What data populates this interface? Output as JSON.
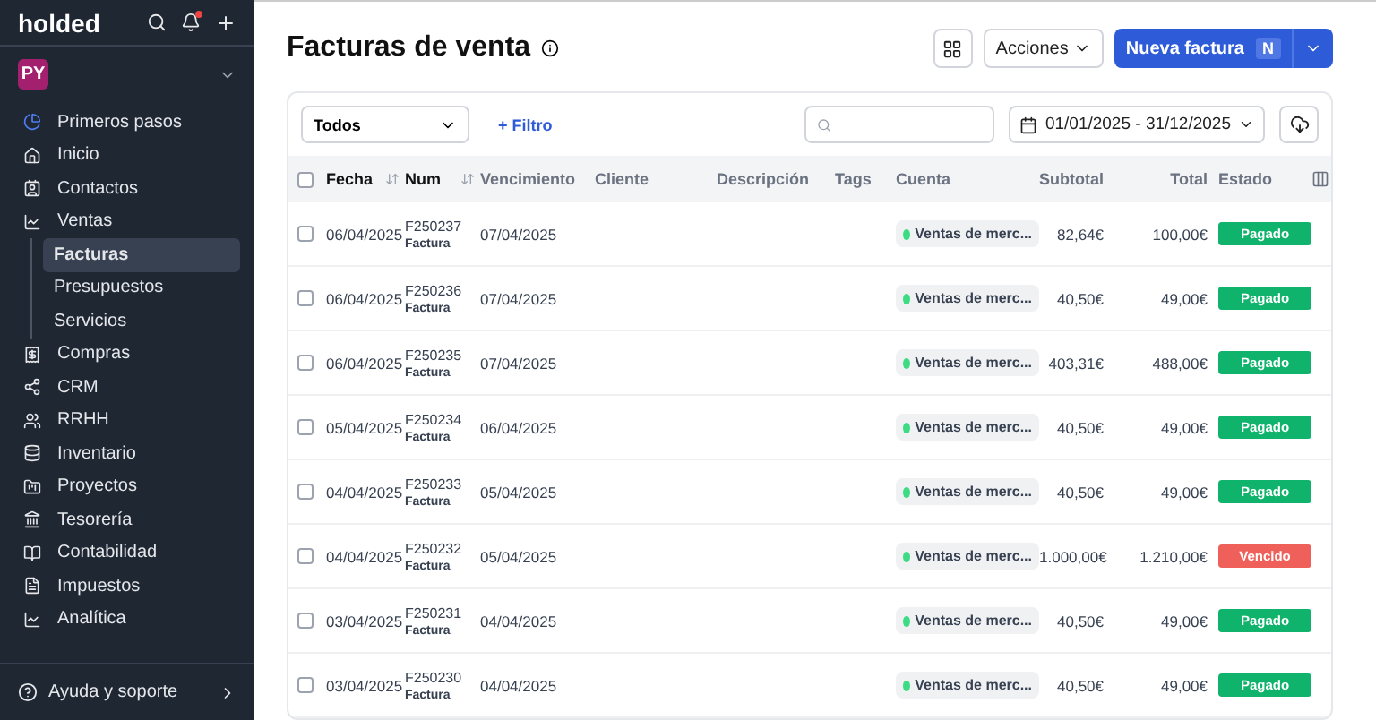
{
  "sidebar": {
    "brand": "holded",
    "notifications": true,
    "workspace": "PY",
    "items": [
      {
        "label": "Primeros pasos",
        "selected": false
      },
      {
        "label": "Inicio",
        "selected": false
      },
      {
        "label": "Contactos",
        "selected": false
      },
      {
        "label": "Ventas",
        "selected": false,
        "expanded": true,
        "children": [
          {
            "label": "Facturas",
            "selected": true
          },
          {
            "label": "Presupuestos",
            "selected": false
          },
          {
            "label": "Servicios",
            "selected": false
          }
        ]
      },
      {
        "label": "Compras",
        "selected": false
      },
      {
        "label": "CRM",
        "selected": false
      },
      {
        "label": "RRHH",
        "selected": false
      },
      {
        "label": "Inventario",
        "selected": false
      },
      {
        "label": "Proyectos",
        "selected": false
      },
      {
        "label": "Tesorería",
        "selected": false
      },
      {
        "label": "Contabilidad",
        "selected": false
      },
      {
        "label": "Impuestos",
        "selected": false
      },
      {
        "label": "Analítica",
        "selected": false
      }
    ],
    "help": "Ayuda y soporte"
  },
  "header": {
    "title": "Facturas de venta",
    "actions_label": "Acciones",
    "primary_label": "Nueva factura",
    "shortcut": "N"
  },
  "toolbar": {
    "filter_value": "Todos",
    "add_filter": "+ Filtro",
    "date_range": "01/01/2025 - 31/12/2025"
  },
  "table": {
    "select_all_checked": false,
    "columns": [
      {
        "label": "Fecha",
        "sortable": true
      },
      {
        "label": "Num",
        "sortable": true
      },
      {
        "label": "Vencimiento",
        "sortable": false
      },
      {
        "label": "Cliente",
        "sortable": false
      },
      {
        "label": "Descripción",
        "sortable": false
      },
      {
        "label": "Tags",
        "sortable": false
      },
      {
        "label": "Cuenta",
        "sortable": false
      },
      {
        "label": "Subtotal",
        "sortable": false
      },
      {
        "label": "Total",
        "sortable": false
      },
      {
        "label": "Estado",
        "sortable": false
      }
    ],
    "rows": [
      {
        "checked": false,
        "date": "06/04/2025",
        "num": "F250237",
        "type": "Factura",
        "due": "07/04/2025",
        "account": "Ventas de merc...",
        "subtotal": "82,64€",
        "total": "100,00€",
        "status": "Pagado",
        "color": "#0fb36b"
      },
      {
        "checked": false,
        "date": "06/04/2025",
        "num": "F250236",
        "type": "Factura",
        "due": "07/04/2025",
        "account": "Ventas de merc...",
        "subtotal": "40,50€",
        "total": "49,00€",
        "status": "Pagado",
        "color": "#0fb36b"
      },
      {
        "checked": false,
        "date": "06/04/2025",
        "num": "F250235",
        "type": "Factura",
        "due": "07/04/2025",
        "account": "Ventas de merc...",
        "subtotal": "403,31€",
        "total": "488,00€",
        "status": "Pagado",
        "color": "#0fb36b"
      },
      {
        "checked": false,
        "date": "05/04/2025",
        "num": "F250234",
        "type": "Factura",
        "due": "06/04/2025",
        "account": "Ventas de merc...",
        "subtotal": "40,50€",
        "total": "49,00€",
        "status": "Pagado",
        "color": "#0fb36b"
      },
      {
        "checked": false,
        "date": "04/04/2025",
        "num": "F250233",
        "type": "Factura",
        "due": "05/04/2025",
        "account": "Ventas de merc...",
        "subtotal": "40,50€",
        "total": "49,00€",
        "status": "Pagado",
        "color": "#0fb36b"
      },
      {
        "checked": false,
        "date": "04/04/2025",
        "num": "F250232",
        "type": "Factura",
        "due": "05/04/2025",
        "account": "Ventas de merc...",
        "subtotal": "1.000,00€",
        "total": "1.210,00€",
        "status": "Vencido",
        "color": "#f0605a"
      },
      {
        "checked": false,
        "date": "03/04/2025",
        "num": "F250231",
        "type": "Factura",
        "due": "04/04/2025",
        "account": "Ventas de merc...",
        "subtotal": "40,50€",
        "total": "49,00€",
        "status": "Pagado",
        "color": "#0fb36b"
      },
      {
        "checked": false,
        "date": "03/04/2025",
        "num": "F250230",
        "type": "Factura",
        "due": "04/04/2025",
        "account": "Ventas de merc...",
        "subtotal": "40,50€",
        "total": "49,00€",
        "status": "Pagado",
        "color": "#0fb36b"
      }
    ]
  }
}
